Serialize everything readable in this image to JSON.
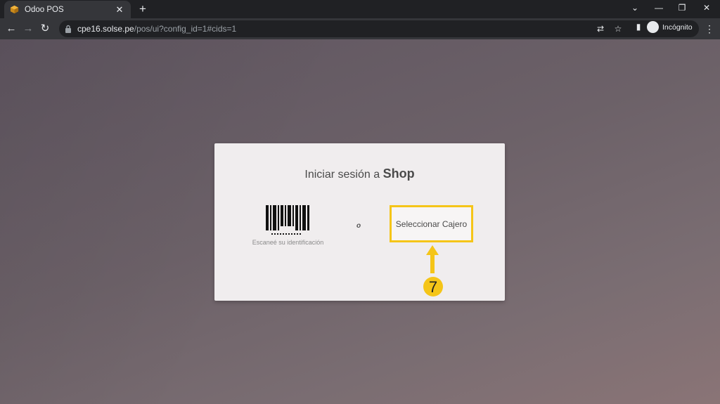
{
  "browser": {
    "tab": {
      "title": "Odoo POS",
      "favicon": "odoo-cube-icon"
    },
    "url": {
      "host": "cpe16.solse.pe",
      "path": "/pos/ui?config_id=1#cids=1"
    },
    "profile_label": "Incógnito"
  },
  "login": {
    "title_prefix": "Iniciar sesión a",
    "shop_name": "Shop",
    "scan_label": "Escaneé su identificación",
    "or_label": "o",
    "select_cashier_label": "Seleccionar Cajero"
  },
  "annotation": {
    "step_number": "7",
    "highlight_color": "#f5c518"
  },
  "colors": {
    "tab_bar": "#202124",
    "toolbar": "#35363a",
    "card_bg": "#f0edee"
  }
}
